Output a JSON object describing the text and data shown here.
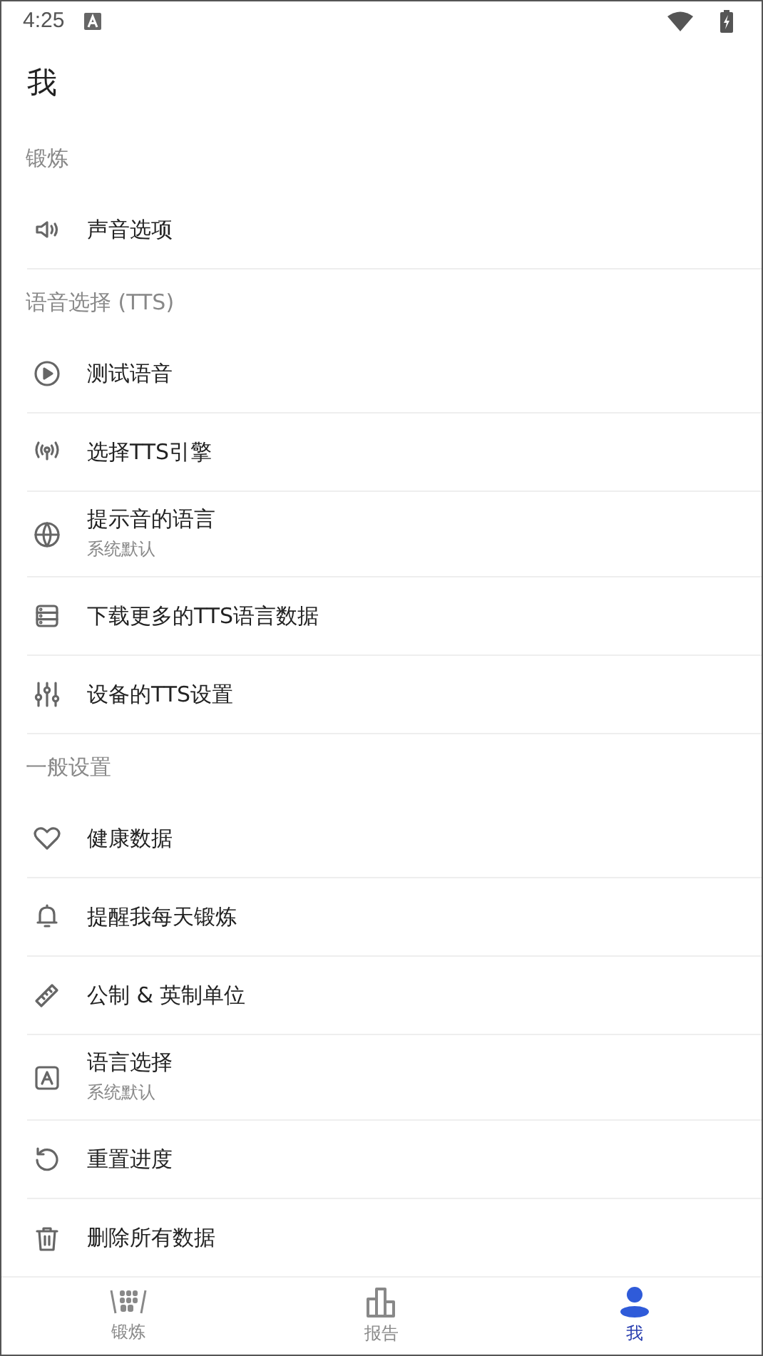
{
  "status_bar": {
    "time": "4:25"
  },
  "title": "我",
  "sections": [
    {
      "header": "锻炼",
      "items": [
        {
          "kind": "speaker",
          "label": "声音选项"
        }
      ]
    },
    {
      "header": "语音选择 (TTS)",
      "items": [
        {
          "kind": "play",
          "label": "测试语音"
        },
        {
          "kind": "broadcast",
          "label": "选择TTS引擎"
        },
        {
          "kind": "globe",
          "label": "提示音的语言",
          "subtitle": "系统默认"
        },
        {
          "kind": "storage",
          "label": "下载更多的TTS语言数据"
        },
        {
          "kind": "sliders",
          "label": "设备的TTS设置"
        }
      ]
    },
    {
      "header": "一般设置",
      "items": [
        {
          "kind": "heart",
          "label": "健康数据"
        },
        {
          "kind": "bell",
          "label": "提醒我每天锻炼"
        },
        {
          "kind": "ruler",
          "label": "公制 & 英制单位"
        },
        {
          "kind": "letter",
          "label": "语言选择",
          "subtitle": "系统默认"
        },
        {
          "kind": "reset",
          "label": "重置进度"
        },
        {
          "kind": "trash",
          "label": "删除所有数据"
        }
      ]
    }
  ],
  "bottom_nav": [
    {
      "kind": "abs",
      "label": "锻炼",
      "selected": false
    },
    {
      "kind": "chart",
      "label": "报告",
      "selected": false
    },
    {
      "kind": "person",
      "label": "我",
      "selected": true
    }
  ]
}
